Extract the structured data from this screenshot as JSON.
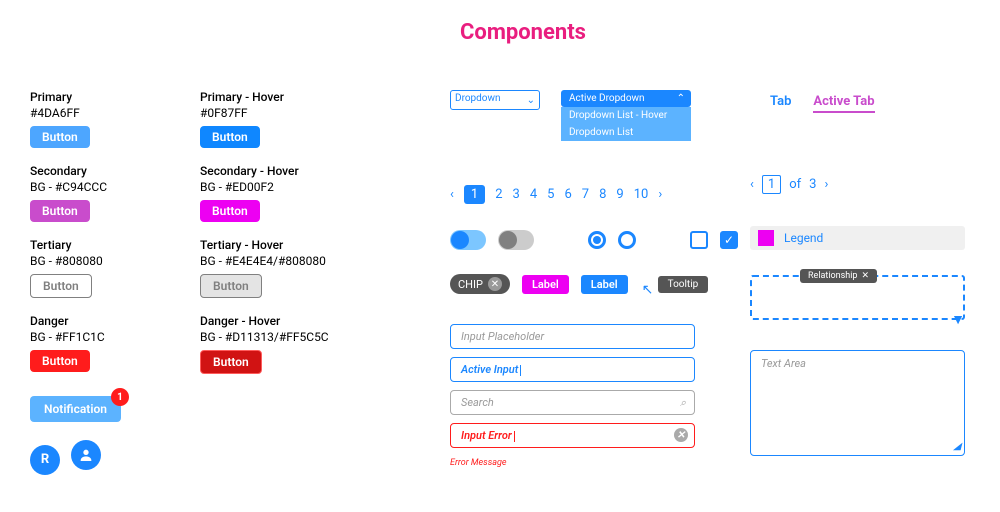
{
  "title": "Components",
  "buttons": {
    "primary": {
      "name": "Primary",
      "code": "#4DA6FF",
      "label": "Button"
    },
    "primary_hover": {
      "name": "Primary - Hover",
      "code": "#0F87FF",
      "label": "Button"
    },
    "secondary": {
      "name": "Secondary",
      "code": "BG - #C94CCC",
      "label": "Button"
    },
    "secondary_hover": {
      "name": "Secondary - Hover",
      "code": "BG - #ED00F2",
      "label": "Button"
    },
    "tertiary": {
      "name": "Tertiary",
      "code": "BG - #808080",
      "label": "Button"
    },
    "tertiary_hover": {
      "name": "Tertiary - Hover",
      "code": "BG - #E4E4E4/#808080",
      "label": "Button"
    },
    "danger": {
      "name": "Danger",
      "code": "BG - #FF1C1C",
      "label": "Button"
    },
    "danger_hover": {
      "name": "Danger - Hover",
      "code": "BG - #D11313/#FF5C5C",
      "label": "Button"
    }
  },
  "notification": {
    "label": "Notification",
    "count": "1"
  },
  "avatar_letter": "R",
  "dropdown": {
    "label": "Dropdown",
    "active_label": "Active Dropdown",
    "item_hover": "Dropdown List - Hover",
    "item": "Dropdown List"
  },
  "tabs": {
    "normal": "Tab",
    "active": "Active Tab"
  },
  "pagination": {
    "numbers": [
      "1",
      "2",
      "3",
      "4",
      "5",
      "6",
      "7",
      "8",
      "9",
      "10"
    ]
  },
  "pagination2": {
    "page": "1",
    "of": "of",
    "total": "3"
  },
  "legend": "Legend",
  "chip": "CHIP",
  "labels": {
    "pink": "Label",
    "blue": "Label"
  },
  "tooltip": "Tooltip",
  "relationship": "Relationship",
  "inputs": {
    "placeholder": "Input Placeholder",
    "active": "Active  Input",
    "search": "Search",
    "error": "Input Error",
    "error_msg": "Error Message"
  },
  "textarea": "Text Area"
}
